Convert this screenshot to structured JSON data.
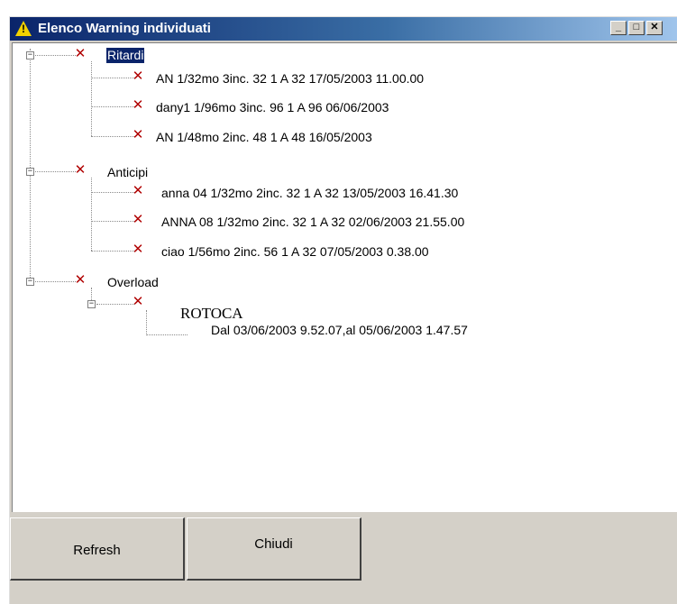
{
  "window": {
    "title": "Elenco Warning individuati",
    "title_icon": "warning-icon",
    "minimize_label": "_",
    "maximize_label": "□",
    "close_label": "✕"
  },
  "tree": {
    "groups": [
      {
        "label": "Ritardi",
        "expander": "−",
        "selected": true,
        "items": [
          "AN 1/32mo 3inc. 32 1 A 32 17/05/2003 11.00.00",
          "dany1 1/96mo 3inc. 96 1 A 96 06/06/2003",
          "AN 1/48mo 2inc. 48 1 A 48 16/05/2003"
        ]
      },
      {
        "label": "Anticipi",
        "expander": "−",
        "items": [
          "anna 04 1/32mo 2inc. 32 1 A 32 13/05/2003 16.41.30",
          "ANNA 08 1/32mo 2inc. 32 1 A 32 02/06/2003 21.55.00",
          "ciao 1/56mo 2inc. 56 1 A 32 07/05/2003 0.38.00"
        ]
      },
      {
        "label": "Overload",
        "expander": "−",
        "child": {
          "label": "ROTOCA",
          "expander": "−",
          "detail": "Dal 03/06/2003 9.52.07,al 05/06/2003 1.47.57"
        }
      }
    ]
  },
  "buttons": {
    "refresh": "Refresh",
    "close": "Chiudi"
  },
  "colors": {
    "titlebar_start": "#0a246a",
    "titlebar_end": "#a6caf0",
    "error_icon": "#b00000",
    "face": "#d4d0c8"
  }
}
